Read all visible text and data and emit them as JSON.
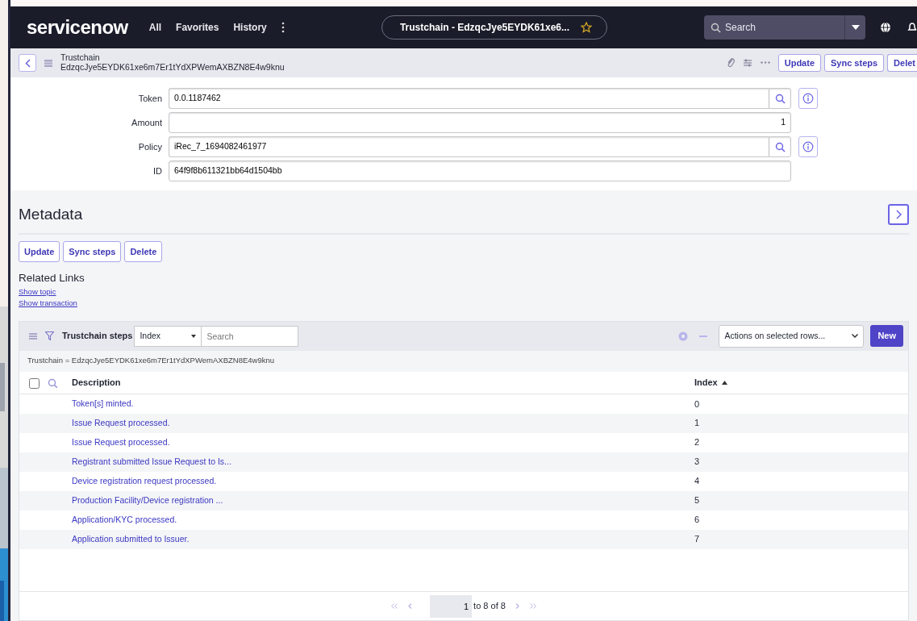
{
  "navbar": {
    "logo": "servicenow",
    "menu": [
      "All",
      "Favorites",
      "History"
    ],
    "context_pill": "Trustchain - EdzqcJye5EYDK61xe6...",
    "search": {
      "placeholder": "Search"
    }
  },
  "header": {
    "record_type": "Trustchain",
    "record_name": "EdzqcJye5EYDK61xe6m7Er1tYdXPWemAXBZN8E4w9knu",
    "buttons": [
      "Update",
      "Sync steps",
      "Delet"
    ]
  },
  "form": {
    "fields": [
      {
        "label": "Token",
        "value": "0.0.1187462",
        "kind": "lookup"
      },
      {
        "label": "Amount",
        "value": "1",
        "kind": "number"
      },
      {
        "label": "Policy",
        "value": "iRec_7_1694082461977",
        "kind": "lookup"
      },
      {
        "label": "ID",
        "value": "64f9f8b611321bb64d1504bb",
        "kind": "text"
      }
    ]
  },
  "metadata": {
    "title": "Metadata",
    "buttons": [
      "Update",
      "Sync steps",
      "Delete"
    ],
    "related_links_title": "Related Links",
    "related_links": [
      "Show topic",
      "Show transaction"
    ]
  },
  "related_list": {
    "title": "Trustchain steps",
    "search_field": "Index",
    "search": {
      "placeholder": "Search"
    },
    "actions": "Actions on selected rows...",
    "new_button": "New",
    "breadcrumb": "Trustchain = EdzqcJye5EYDK61xe6m7Er1tYdXPWemAXBZN8E4w9knu",
    "select_all": {
      "checked": false
    },
    "columns": [
      "Description",
      "Index"
    ],
    "rows": [
      {
        "description": "Token[s] minted.",
        "index": "0"
      },
      {
        "description": "Issue Request processed.",
        "index": "1"
      },
      {
        "description": "Issue Request processed.",
        "index": "2"
      },
      {
        "description": "Registrant submitted Issue Request to Is...",
        "index": "3"
      },
      {
        "description": "Device registration request processed.",
        "index": "4"
      },
      {
        "description": "Production Facility/Device registration ...",
        "index": "5"
      },
      {
        "description": "Application/KYC processed.",
        "index": "6"
      },
      {
        "description": "Application submitted to Issuer.",
        "index": "7"
      }
    ],
    "pagination": {
      "page": "1",
      "range": "to 8 of 8"
    }
  }
}
